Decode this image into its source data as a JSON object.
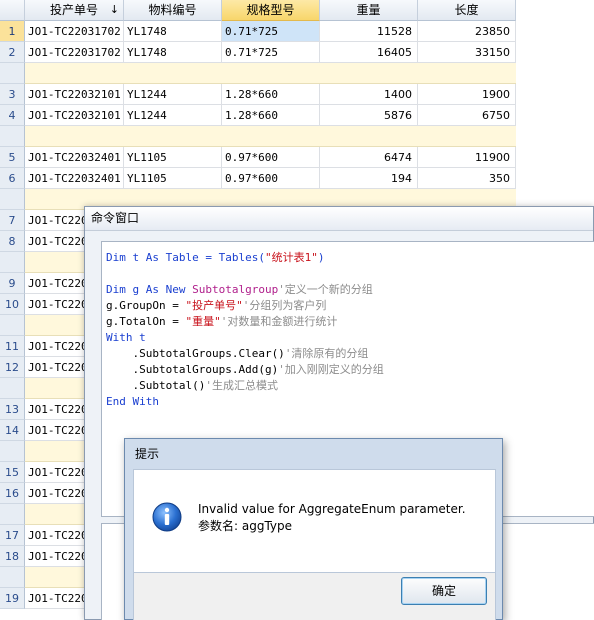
{
  "grid": {
    "columns": [
      "投产单号",
      "物料编号",
      "规格型号",
      "重量",
      "长度"
    ],
    "sort_indicator": "↓",
    "rows": [
      {
        "num": "1",
        "cells": [
          "JO1-TC22031702",
          "YL1748",
          "0.71*725",
          "11528",
          "23850"
        ]
      },
      {
        "num": "2",
        "cells": [
          "JO1-TC22031702",
          "YL1748",
          "0.71*725",
          "16405",
          "33150"
        ]
      },
      {
        "num": "3",
        "cells": [
          "JO1-TC22032101",
          "YL1244",
          "1.28*660",
          "1400",
          "1900"
        ]
      },
      {
        "num": "4",
        "cells": [
          "JO1-TC22032101",
          "YL1244",
          "1.28*660",
          "5876",
          "6750"
        ]
      },
      {
        "num": "5",
        "cells": [
          "JO1-TC22032401",
          "YL1105",
          "0.97*600",
          "6474",
          "11900"
        ]
      },
      {
        "num": "6",
        "cells": [
          "JO1-TC22032401",
          "YL1105",
          "0.97*600",
          "194",
          "350"
        ]
      },
      {
        "num": "7",
        "cells": [
          "JO1-TC220",
          "",
          "",
          "",
          ""
        ]
      },
      {
        "num": "8",
        "cells": [
          "JO1-TC220",
          "",
          "",
          "",
          ""
        ]
      },
      {
        "num": "9",
        "cells": [
          "JO1-TC220",
          "",
          "",
          "",
          ""
        ]
      },
      {
        "num": "10",
        "cells": [
          "JO1-TC220",
          "",
          "",
          "",
          ""
        ]
      },
      {
        "num": "11",
        "cells": [
          "JO1-TC220",
          "",
          "",
          "",
          ""
        ]
      },
      {
        "num": "12",
        "cells": [
          "JO1-TC220",
          "",
          "",
          "",
          ""
        ]
      },
      {
        "num": "13",
        "cells": [
          "JO1-TC220",
          "",
          "",
          "",
          ""
        ]
      },
      {
        "num": "14",
        "cells": [
          "JO1-TC220",
          "",
          "",
          "",
          ""
        ]
      },
      {
        "num": "15",
        "cells": [
          "JO1-TC220",
          "",
          "",
          "",
          ""
        ]
      },
      {
        "num": "16",
        "cells": [
          "JO1-TC220",
          "",
          "",
          "",
          ""
        ]
      },
      {
        "num": "17",
        "cells": [
          "JO1-TC220",
          "",
          "",
          "",
          ""
        ]
      },
      {
        "num": "18",
        "cells": [
          "JO1-TC220",
          "",
          "",
          "",
          ""
        ]
      },
      {
        "num": "19",
        "cells": [
          "JO1-TC220",
          "",
          "",
          "",
          ""
        ]
      }
    ]
  },
  "command_window": {
    "title": "命令窗口",
    "code": {
      "l1_kw": "Dim t As Table = Tables(",
      "l1_str": "\"统计表1\"",
      "l1_end": ")",
      "l2_a": "Dim g As New ",
      "l2_cls": "Subtotalgroup",
      "l2_cmt": "'定义一个新的分组",
      "l3_a": "g.GroupOn = ",
      "l3_str": "\"投产单号\"",
      "l3_cmt": "'分组列为客户列",
      "l4_a": "g.TotalOn = ",
      "l4_str": "\"重量\"",
      "l4_cmt": "'对数量和金额进行统计",
      "l5": "With t",
      "l6_a": "    .SubtotalGroups.Clear()",
      "l6_cmt": "'清除原有的分组",
      "l7_a": "    .SubtotalGroups.Add(g)",
      "l7_cmt": "'加入刚刚定义的分组",
      "l8_a": "    .Subtotal()",
      "l8_cmt": "'生成汇总模式",
      "l9": "End With"
    }
  },
  "dialog": {
    "title": "提示",
    "message_line1": "Invalid value for AggregateEnum parameter.",
    "message_line2": "参数名: aggType",
    "ok_label": "确定",
    "icon": "info-icon"
  },
  "colors": {
    "active_header": "#f8d66b",
    "selected_cell": "#cfe4f8",
    "keyword": "#1a3fd0",
    "string": "#c8121b",
    "comment": "#8c8c8c",
    "info_icon": "#1f5fbf"
  }
}
